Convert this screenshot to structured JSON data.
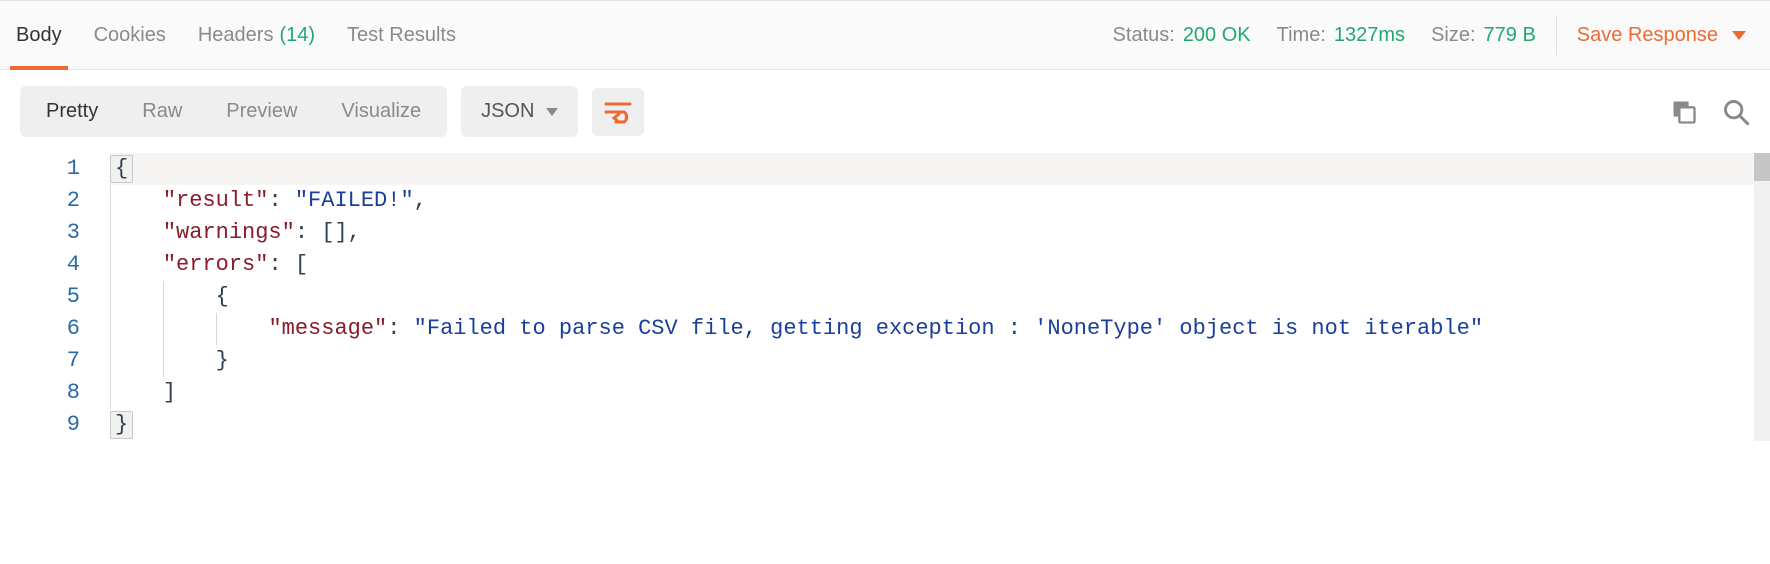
{
  "tabs": {
    "body": "Body",
    "cookies": "Cookies",
    "headers_label": "Headers",
    "headers_count": "(14)",
    "test_results": "Test Results"
  },
  "meta": {
    "status_label": "Status:",
    "status_value": "200 OK",
    "time_label": "Time:",
    "time_value": "1327ms",
    "size_label": "Size:",
    "size_value": "779 B"
  },
  "save_response": "Save Response",
  "view_modes": {
    "pretty": "Pretty",
    "raw": "Raw",
    "preview": "Preview",
    "visualize": "Visualize"
  },
  "format_selector": "JSON",
  "code": {
    "line_numbers": [
      "1",
      "2",
      "3",
      "4",
      "5",
      "6",
      "7",
      "8",
      "9"
    ],
    "k_result": "\"result\"",
    "v_result": "\"FAILED!\"",
    "k_warnings": "\"warnings\"",
    "k_errors": "\"errors\"",
    "k_message": "\"message\"",
    "v_message": "\"Failed to parse CSV file, getting exception : 'NoneType' object is not iterable\"",
    "brace_open": "{",
    "brace_close": "}",
    "bracket_open": "[",
    "bracket_close": "]",
    "brackets_empty": "[]",
    "colon": ":",
    "comma": ","
  }
}
